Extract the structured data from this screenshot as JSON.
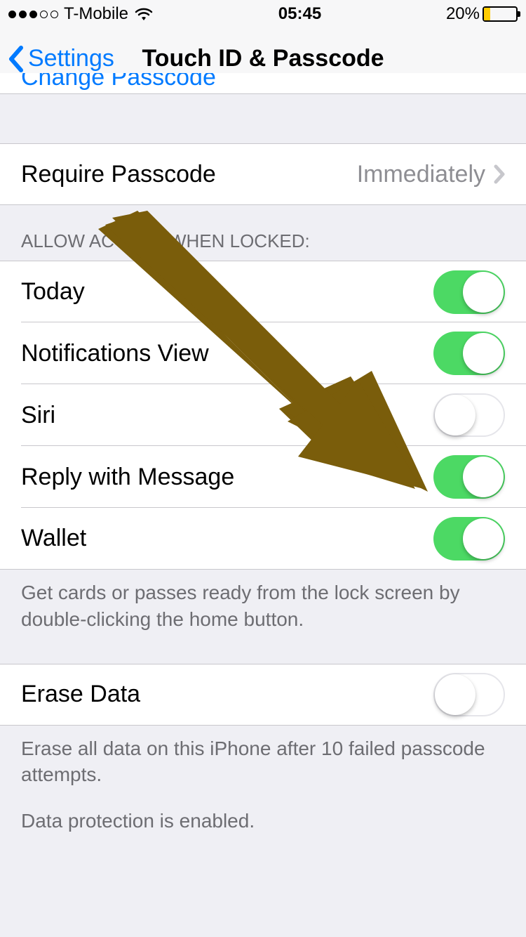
{
  "status": {
    "carrier": "T-Mobile",
    "time": "05:45",
    "battery_pct": "20%"
  },
  "nav": {
    "back_label": "Settings",
    "title": "Touch ID & Passcode"
  },
  "partial_row": {
    "label": "Change Passcode"
  },
  "require": {
    "label": "Require Passcode",
    "value": "Immediately"
  },
  "allow_header": "ALLOW ACCESS WHEN LOCKED:",
  "toggles": {
    "today": {
      "label": "Today",
      "on": true
    },
    "notifications": {
      "label": "Notifications View",
      "on": true
    },
    "siri": {
      "label": "Siri",
      "on": false
    },
    "reply": {
      "label": "Reply with Message",
      "on": true
    },
    "wallet": {
      "label": "Wallet",
      "on": true
    }
  },
  "wallet_footer": "Get cards or passes ready from the lock screen by double-clicking the home button.",
  "erase": {
    "label": "Erase Data",
    "on": false
  },
  "erase_footer_1": "Erase all data on this iPhone after 10 failed passcode attempts.",
  "erase_footer_2": "Data protection is enabled.",
  "colors": {
    "tint": "#007aff",
    "switch_on": "#4cd964",
    "battery_low": "#ffcc00",
    "annotation": "#7a5d0b"
  }
}
